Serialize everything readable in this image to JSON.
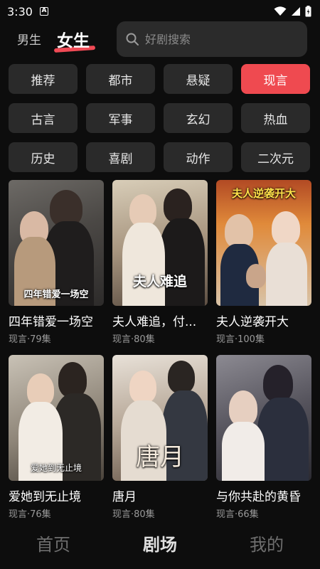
{
  "status_bar": {
    "time": "3:30",
    "notification_badge": "A"
  },
  "header": {
    "gender_tabs": [
      {
        "label": "男生",
        "active": false
      },
      {
        "label": "女生",
        "active": true
      }
    ],
    "search": {
      "placeholder": "好剧搜索"
    },
    "accent_color": "#ef4a50"
  },
  "categories": [
    {
      "label": "推荐",
      "active": false
    },
    {
      "label": "都市",
      "active": false
    },
    {
      "label": "悬疑",
      "active": false
    },
    {
      "label": "现言",
      "active": true
    },
    {
      "label": "古言",
      "active": false
    },
    {
      "label": "军事",
      "active": false
    },
    {
      "label": "玄幻",
      "active": false
    },
    {
      "label": "热血",
      "active": false
    },
    {
      "label": "历史",
      "active": false
    },
    {
      "label": "喜剧",
      "active": false
    },
    {
      "label": "动作",
      "active": false
    },
    {
      "label": "二次元",
      "active": false
    }
  ],
  "dramas": [
    {
      "title": "四年错爱一场空",
      "meta": "现言·79集",
      "poster_text": "四年错爱一场空"
    },
    {
      "title": "夫人难追，付...",
      "meta": "现言·80集",
      "poster_text": "夫人难追"
    },
    {
      "title": "夫人逆袭开大",
      "meta": "现言·100集",
      "poster_text": "夫人逆袭开大"
    },
    {
      "title": "爱她到无止境",
      "meta": "现言·76集",
      "poster_text": "爱她到无止境"
    },
    {
      "title": "唐月",
      "meta": "现言·80集",
      "poster_text": "唐月"
    },
    {
      "title": "与你共赴的黄昏",
      "meta": "现言·66集",
      "poster_text": ""
    }
  ],
  "bottom_nav": [
    {
      "label": "首页",
      "active": false
    },
    {
      "label": "剧场",
      "active": true
    },
    {
      "label": "我的",
      "active": false
    }
  ]
}
